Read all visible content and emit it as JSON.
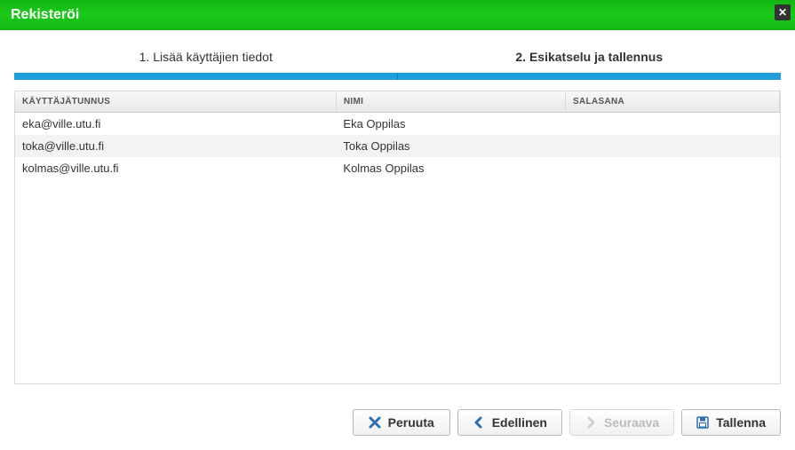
{
  "header": {
    "title": "Rekisteröi"
  },
  "steps": {
    "step1": "1. Lisää käyttäjien tiedot",
    "step2": "2. Esikatselu ja tallennus",
    "active": 2
  },
  "table": {
    "columns": {
      "user": "KÄYTTÄJÄTUNNUS",
      "name": "NIMI",
      "password": "SALASANA"
    },
    "rows": [
      {
        "user": "eka@ville.utu.fi",
        "name": "Eka Oppilas",
        "password": ""
      },
      {
        "user": "toka@ville.utu.fi",
        "name": "Toka Oppilas",
        "password": ""
      },
      {
        "user": "kolmas@ville.utu.fi",
        "name": "Kolmas Oppilas",
        "password": ""
      }
    ]
  },
  "buttons": {
    "cancel": "Peruuta",
    "prev": "Edellinen",
    "next": "Seuraava",
    "save": "Tallenna"
  }
}
